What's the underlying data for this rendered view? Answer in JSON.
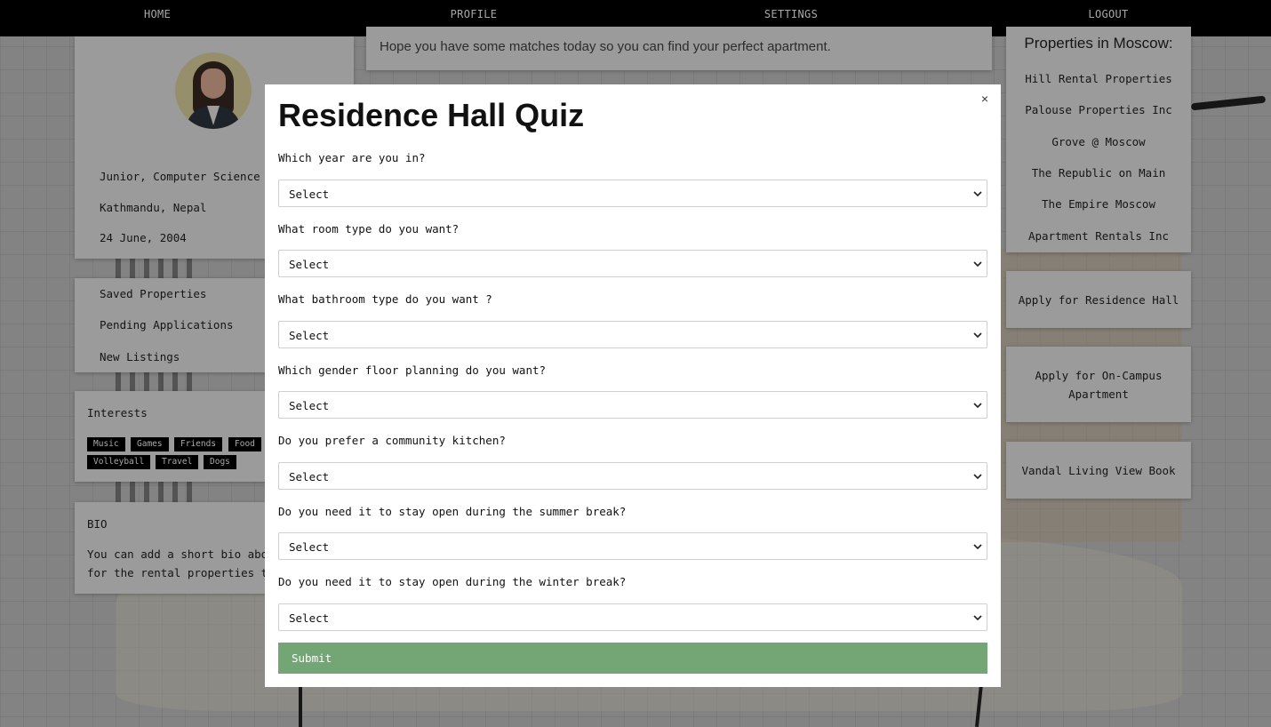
{
  "nav": {
    "home": "HOME",
    "profile": "PROFILE",
    "settings": "SETTINGS",
    "logout": "LOGOUT"
  },
  "welcome": {
    "text": "Hope you have some matches today so you can find your perfect apartment."
  },
  "profile": {
    "details": [
      "Junior, Computer Science",
      "Kathmandu, Nepal",
      "24 June, 2004"
    ]
  },
  "side_links": [
    "Saved Properties",
    "Pending Applications",
    "New Listings"
  ],
  "interests": {
    "title": "Interests",
    "tags": [
      "Music",
      "Games",
      "Friends",
      "Food",
      "Volleyball",
      "Travel",
      "Dogs"
    ]
  },
  "bio": {
    "title": "BIO",
    "lines": [
      "You can add a short bio about",
      "for the rental properties to"
    ]
  },
  "properties": {
    "title": "Properties in Moscow:",
    "items": [
      "Hill Rental Properties",
      "Palouse Properties Inc",
      "Grove @ Moscow",
      "The Republic on Main",
      "The Empire Moscow",
      "Apartment Rentals Inc"
    ]
  },
  "actions": [
    "Apply for Residence Hall",
    "Apply for On-Campus Apartment",
    "Vandal Living View Book"
  ],
  "quiz": {
    "title": "Residence Hall Quiz",
    "close": "×",
    "questions": [
      {
        "label": "Which year are you in?",
        "value": "Select"
      },
      {
        "label": "What room type do you want?",
        "value": "Select"
      },
      {
        "label": "What bathroom type do you want ?",
        "value": "Select"
      },
      {
        "label": "Which gender floor planning do you want?",
        "value": "Select"
      },
      {
        "label": "Do you prefer a community kitchen?",
        "value": "Select"
      },
      {
        "label": "Do you need it to stay open during the summer break?",
        "value": "Select"
      },
      {
        "label": "Do you need it to stay open during the winter break?",
        "value": "Select"
      }
    ],
    "submit": "Submit"
  },
  "colors": {
    "nav_bg": "#000000",
    "submit_bg": "#74a574",
    "card_bg": "#efefef"
  }
}
